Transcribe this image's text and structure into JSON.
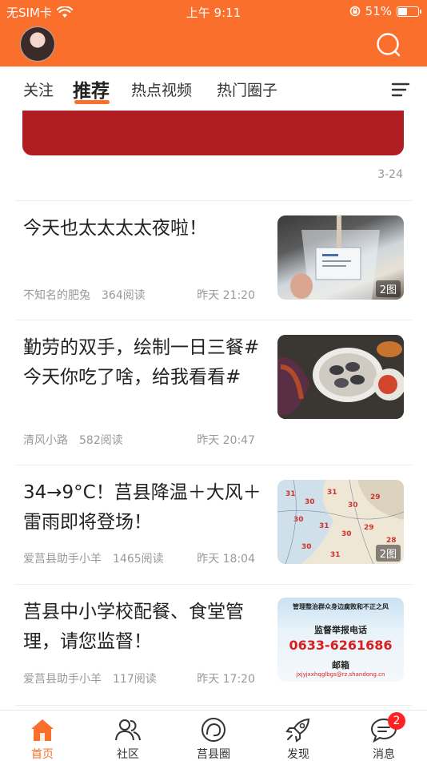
{
  "status_bar": {
    "carrier": "无SIM卡",
    "time": "上午 9:11",
    "battery": "51%",
    "battery_level": 0.51
  },
  "header": {
    "avatar_icon": "user-avatar",
    "search_icon": "search-icon"
  },
  "tabs": [
    {
      "label": "关注",
      "active": false
    },
    {
      "label": "推荐",
      "active": true
    },
    {
      "label": "热点视频",
      "active": false
    },
    {
      "label": "热门圈子",
      "active": false
    }
  ],
  "tabs_menu_icon": "menu-lines-icon",
  "banner": {
    "date": "3-24"
  },
  "feed": [
    {
      "title": "今天也太太太太夜啦！",
      "author": "不知名的肥兔",
      "reads": "364阅读",
      "time": "昨天 21:20",
      "thumb_badge": "2图"
    },
    {
      "title": "勤劳的双手，绘制一日三餐#今天你吃了啥，给我看看#",
      "author": "清风小路",
      "reads": "582阅读",
      "time": "昨天 20:47",
      "thumb_badge": ""
    },
    {
      "title": "34→9°C！莒县降温＋大风＋雷雨即将登场！",
      "author": "爱莒县助手小羊",
      "reads": "1465阅读",
      "time": "昨天 18:04",
      "thumb_badge": "2图"
    },
    {
      "title": "莒县中小学校配餐、食堂管理，请您监督！",
      "author": "爱莒县助手小羊",
      "reads": "117阅读",
      "time": "昨天 17:20",
      "thumb_badge": "",
      "thumb_text": {
        "line1": "管理整治群众身边腐败和不正之风",
        "line2": "监督举报电话",
        "phone": "0633-6261686",
        "line3": "邮箱",
        "email": "jxjyjxxhqglbgs@rz.shandong.cn"
      }
    }
  ],
  "tabbar": [
    {
      "label": "首页",
      "icon": "home-icon",
      "active": true
    },
    {
      "label": "社区",
      "icon": "community-icon",
      "active": false
    },
    {
      "label": "莒县圈",
      "icon": "circle-icon",
      "active": false
    },
    {
      "label": "发现",
      "icon": "rocket-icon",
      "active": false
    },
    {
      "label": "消息",
      "icon": "message-icon",
      "active": false,
      "badge": "2"
    }
  ],
  "colors": {
    "accent": "#fa6f2c",
    "badge": "#ff2222"
  }
}
